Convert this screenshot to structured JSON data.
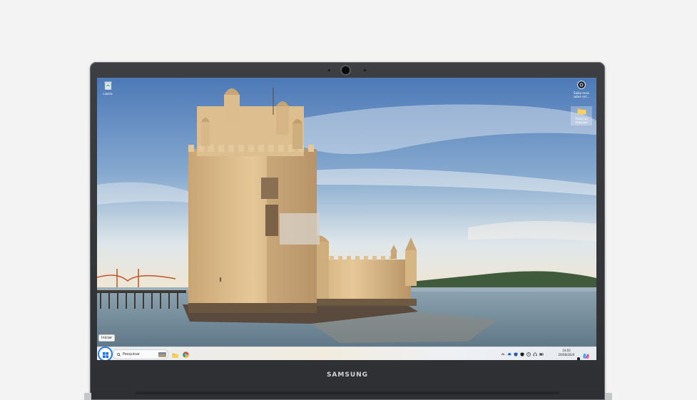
{
  "device": {
    "brand": "SAMSUNG",
    "frame_color": "#34363a",
    "background_color": "#f3f3f3"
  },
  "desktop": {
    "wallpaper_colors": {
      "sky_top": "#4f7fbe",
      "sky_bottom": "#dfe7ea",
      "stone": "#d9b98a",
      "water": "#7f97a8"
    },
    "icons": [
      {
        "name": "recycle-bin",
        "icon": "recycle-icon",
        "label": "Lixeira"
      },
      {
        "name": "learn-more",
        "icon": "camera-icon",
        "label": "Saiba mais sobre est..."
      },
      {
        "name": "all-files",
        "icon": "folder-icon",
        "label": "Todos os arquivos"
      }
    ],
    "start_tooltip": "Iniciar"
  },
  "taskbar": {
    "start_icon": "windows-icon",
    "search": {
      "icon": "search-icon",
      "placeholder": "Pesquisar"
    },
    "apps": [
      {
        "name": "file-explorer",
        "icon": "folder-icon"
      },
      {
        "name": "chrome",
        "icon": "chrome-icon"
      }
    ],
    "tray_icons": [
      "chevron-up-icon",
      "cloud-icon",
      "shield-icon",
      "shield-icon",
      "clock-icon",
      "headset-icon",
      "battery-icon"
    ],
    "clock": {
      "time": "14:02",
      "date": "20/08/2024"
    },
    "notification_icon": "bell-icon",
    "copilot_icon": "copilot-icon",
    "accent_color": "#2a7de1"
  }
}
